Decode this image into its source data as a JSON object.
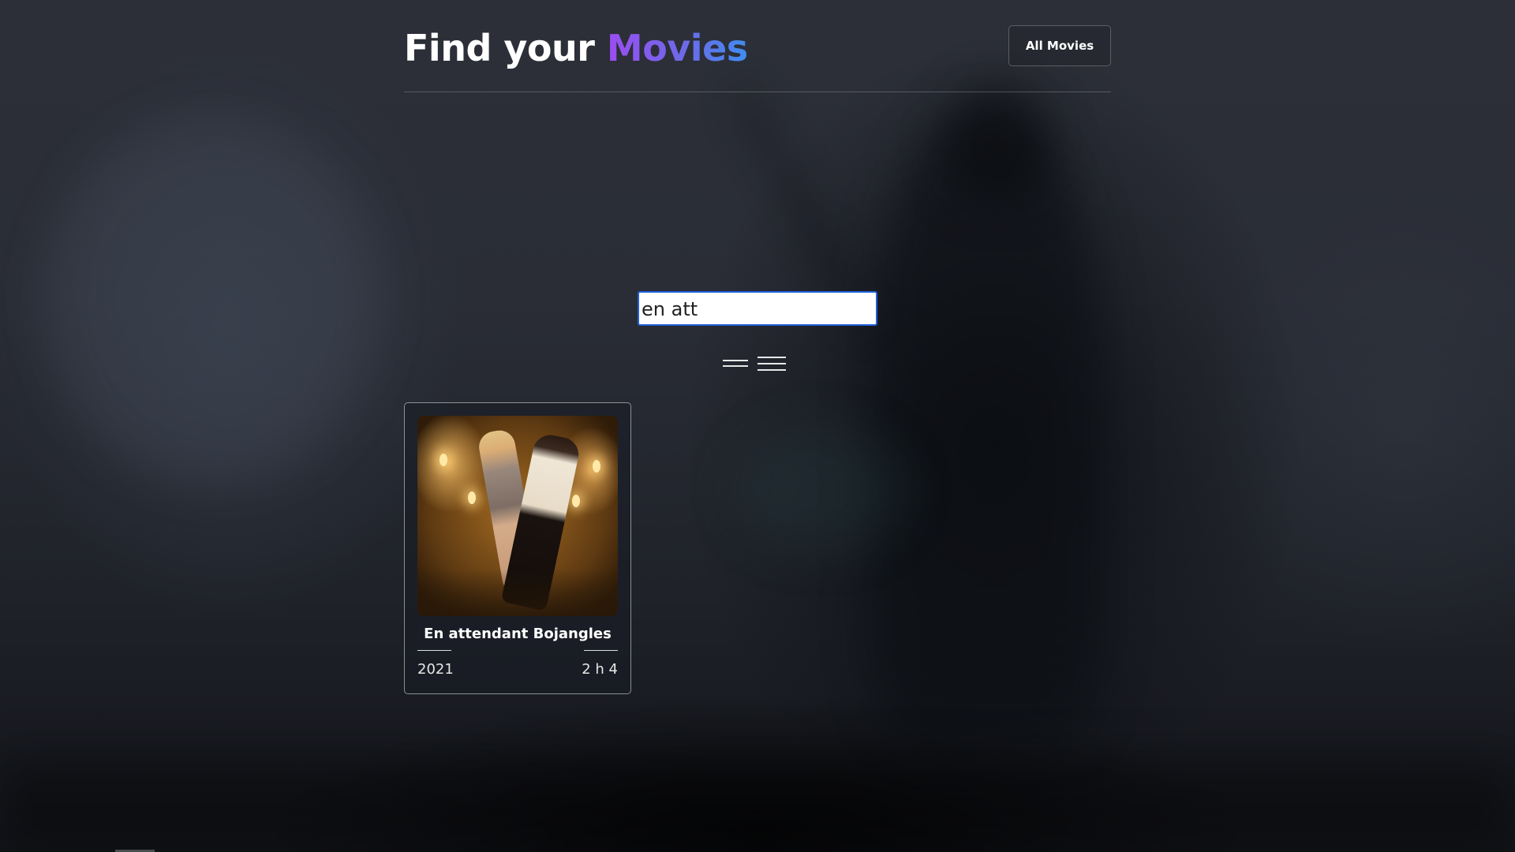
{
  "header": {
    "title_prefix": "Find your",
    "title_accent": "Movies",
    "all_movies_button": "All Movies"
  },
  "colors": {
    "accent_gradient_start": "#9b4df0",
    "accent_gradient_end": "#3f8df0",
    "input_focus_border": "#1f5fd6"
  },
  "search": {
    "value": "en att",
    "placeholder": ""
  },
  "view_toggles": [
    {
      "icon": "two-lines-icon"
    },
    {
      "icon": "three-lines-icon"
    }
  ],
  "results": [
    {
      "title": "En attendant Bojangles",
      "year": "2021",
      "duration": "2 h 4"
    }
  ]
}
